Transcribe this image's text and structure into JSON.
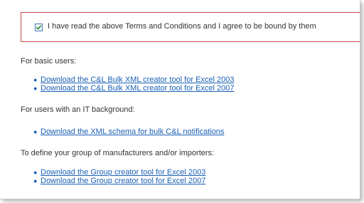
{
  "terms": {
    "checked": true,
    "label": "I have read the above Terms and Conditions and I agree to be bound by them"
  },
  "sections": [
    {
      "heading": "For basic users:",
      "links": [
        "Download the C&L Bulk XML creator tool for Excel 2003",
        "Download the C&L Bulk XML creator tool for Excel 2007"
      ]
    },
    {
      "heading": "For users with an IT background:",
      "links": [
        "Download the XML schema for bulk C&L notifications"
      ]
    },
    {
      "heading": "To define your group of manufacturers and/or importers:",
      "links": [
        "Download the Group creator tool for Excel 2003",
        "Download the Group creator tool for Excel 2007"
      ]
    }
  ],
  "colors": {
    "link": "#1a5fb4",
    "terms_border": "#c44a4a",
    "text": "#333333"
  }
}
